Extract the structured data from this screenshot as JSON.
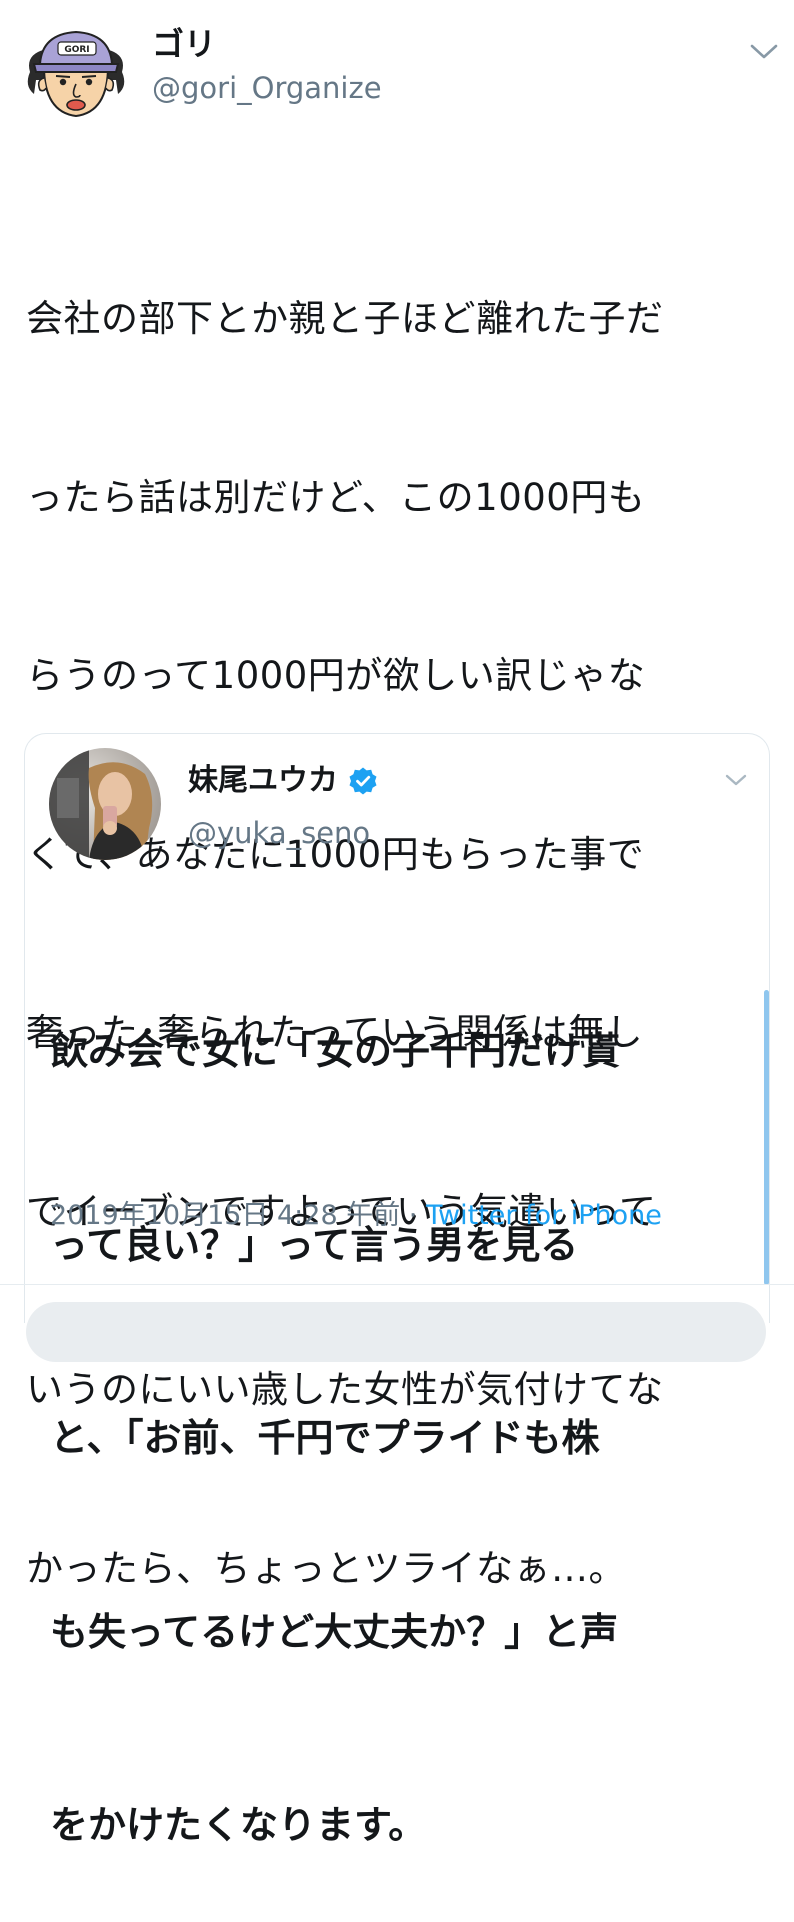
{
  "tweet": {
    "author_name": "ゴリ",
    "author_handle": "@gori_Organize",
    "avatar_cap_text": "GORI",
    "text_lines": [
      "会社の部下とか親と子ほど離れた子だ",
      "ったら話は別だけど、この1000円も",
      "らうのって1000円が欲しい訳じゃな",
      "くて、あなたに1000円もらった事で",
      "奢った･奢られたっていう関係は無し",
      "でイーブンですよっていう気遣いって",
      "いうのにいい歳した女性が気付けてな",
      "かったら、ちょっとツライなぁ…。"
    ]
  },
  "quoted_tweet": {
    "author_name": "妹尾ユウカ",
    "author_handle": "@yuka_seno",
    "text_lines": [
      "飲み会で女に「女の子千円だけ貰",
      "って良い？」って言う男を見る",
      "と、「お前、千円でプライドも株",
      "も失ってるけど大丈夫か？」と声",
      "をかけたくなります。"
    ],
    "timestamp": "2019年10月15日 4:28 午前 · ",
    "source": "Twitter for iPhone"
  },
  "colors": {
    "text_primary": "#14171a",
    "text_secondary": "#657786",
    "link_blue": "#1da1f2",
    "verified_blue": "#1da1f2",
    "border": "#e1e8ed"
  },
  "icons": {
    "caret": "chevron-down-icon",
    "verified": "verified-badge-icon"
  }
}
